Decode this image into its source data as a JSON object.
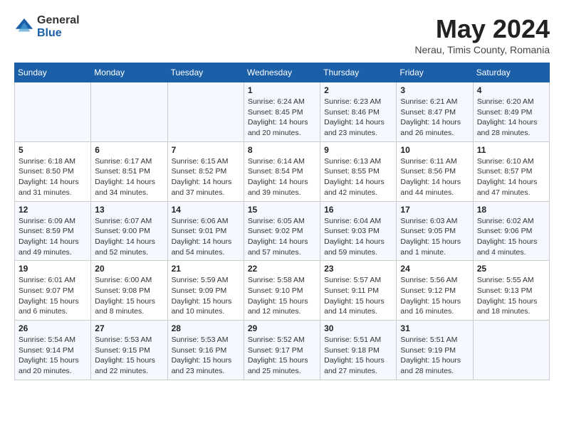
{
  "header": {
    "logo_general": "General",
    "logo_blue": "Blue",
    "month_title": "May 2024",
    "location": "Nerau, Timis County, Romania"
  },
  "days_of_week": [
    "Sunday",
    "Monday",
    "Tuesday",
    "Wednesday",
    "Thursday",
    "Friday",
    "Saturday"
  ],
  "weeks": [
    [
      {
        "day": "",
        "content": ""
      },
      {
        "day": "",
        "content": ""
      },
      {
        "day": "",
        "content": ""
      },
      {
        "day": "1",
        "content": "Sunrise: 6:24 AM\nSunset: 8:45 PM\nDaylight: 14 hours\nand 20 minutes."
      },
      {
        "day": "2",
        "content": "Sunrise: 6:23 AM\nSunset: 8:46 PM\nDaylight: 14 hours\nand 23 minutes."
      },
      {
        "day": "3",
        "content": "Sunrise: 6:21 AM\nSunset: 8:47 PM\nDaylight: 14 hours\nand 26 minutes."
      },
      {
        "day": "4",
        "content": "Sunrise: 6:20 AM\nSunset: 8:49 PM\nDaylight: 14 hours\nand 28 minutes."
      }
    ],
    [
      {
        "day": "5",
        "content": "Sunrise: 6:18 AM\nSunset: 8:50 PM\nDaylight: 14 hours\nand 31 minutes."
      },
      {
        "day": "6",
        "content": "Sunrise: 6:17 AM\nSunset: 8:51 PM\nDaylight: 14 hours\nand 34 minutes."
      },
      {
        "day": "7",
        "content": "Sunrise: 6:15 AM\nSunset: 8:52 PM\nDaylight: 14 hours\nand 37 minutes."
      },
      {
        "day": "8",
        "content": "Sunrise: 6:14 AM\nSunset: 8:54 PM\nDaylight: 14 hours\nand 39 minutes."
      },
      {
        "day": "9",
        "content": "Sunrise: 6:13 AM\nSunset: 8:55 PM\nDaylight: 14 hours\nand 42 minutes."
      },
      {
        "day": "10",
        "content": "Sunrise: 6:11 AM\nSunset: 8:56 PM\nDaylight: 14 hours\nand 44 minutes."
      },
      {
        "day": "11",
        "content": "Sunrise: 6:10 AM\nSunset: 8:57 PM\nDaylight: 14 hours\nand 47 minutes."
      }
    ],
    [
      {
        "day": "12",
        "content": "Sunrise: 6:09 AM\nSunset: 8:59 PM\nDaylight: 14 hours\nand 49 minutes."
      },
      {
        "day": "13",
        "content": "Sunrise: 6:07 AM\nSunset: 9:00 PM\nDaylight: 14 hours\nand 52 minutes."
      },
      {
        "day": "14",
        "content": "Sunrise: 6:06 AM\nSunset: 9:01 PM\nDaylight: 14 hours\nand 54 minutes."
      },
      {
        "day": "15",
        "content": "Sunrise: 6:05 AM\nSunset: 9:02 PM\nDaylight: 14 hours\nand 57 minutes."
      },
      {
        "day": "16",
        "content": "Sunrise: 6:04 AM\nSunset: 9:03 PM\nDaylight: 14 hours\nand 59 minutes."
      },
      {
        "day": "17",
        "content": "Sunrise: 6:03 AM\nSunset: 9:05 PM\nDaylight: 15 hours\nand 1 minute."
      },
      {
        "day": "18",
        "content": "Sunrise: 6:02 AM\nSunset: 9:06 PM\nDaylight: 15 hours\nand 4 minutes."
      }
    ],
    [
      {
        "day": "19",
        "content": "Sunrise: 6:01 AM\nSunset: 9:07 PM\nDaylight: 15 hours\nand 6 minutes."
      },
      {
        "day": "20",
        "content": "Sunrise: 6:00 AM\nSunset: 9:08 PM\nDaylight: 15 hours\nand 8 minutes."
      },
      {
        "day": "21",
        "content": "Sunrise: 5:59 AM\nSunset: 9:09 PM\nDaylight: 15 hours\nand 10 minutes."
      },
      {
        "day": "22",
        "content": "Sunrise: 5:58 AM\nSunset: 9:10 PM\nDaylight: 15 hours\nand 12 minutes."
      },
      {
        "day": "23",
        "content": "Sunrise: 5:57 AM\nSunset: 9:11 PM\nDaylight: 15 hours\nand 14 minutes."
      },
      {
        "day": "24",
        "content": "Sunrise: 5:56 AM\nSunset: 9:12 PM\nDaylight: 15 hours\nand 16 minutes."
      },
      {
        "day": "25",
        "content": "Sunrise: 5:55 AM\nSunset: 9:13 PM\nDaylight: 15 hours\nand 18 minutes."
      }
    ],
    [
      {
        "day": "26",
        "content": "Sunrise: 5:54 AM\nSunset: 9:14 PM\nDaylight: 15 hours\nand 20 minutes."
      },
      {
        "day": "27",
        "content": "Sunrise: 5:53 AM\nSunset: 9:15 PM\nDaylight: 15 hours\nand 22 minutes."
      },
      {
        "day": "28",
        "content": "Sunrise: 5:53 AM\nSunset: 9:16 PM\nDaylight: 15 hours\nand 23 minutes."
      },
      {
        "day": "29",
        "content": "Sunrise: 5:52 AM\nSunset: 9:17 PM\nDaylight: 15 hours\nand 25 minutes."
      },
      {
        "day": "30",
        "content": "Sunrise: 5:51 AM\nSunset: 9:18 PM\nDaylight: 15 hours\nand 27 minutes."
      },
      {
        "day": "31",
        "content": "Sunrise: 5:51 AM\nSunset: 9:19 PM\nDaylight: 15 hours\nand 28 minutes."
      },
      {
        "day": "",
        "content": ""
      }
    ]
  ]
}
